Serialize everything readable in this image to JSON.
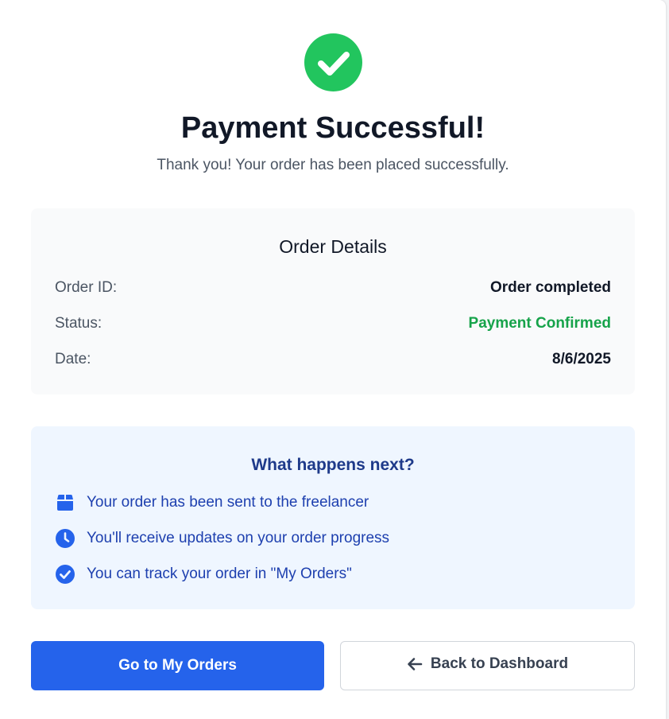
{
  "header": {
    "icon": "check-circle-icon",
    "title": "Payment Successful!",
    "subtitle": "Thank you! Your order has been placed successfully."
  },
  "order_details": {
    "heading": "Order Details",
    "rows": [
      {
        "label": "Order ID:",
        "value": "Order completed"
      },
      {
        "label": "Status:",
        "value": "Payment Confirmed"
      },
      {
        "label": "Date:",
        "value": "8/6/2025"
      }
    ]
  },
  "next_steps": {
    "heading": "What happens next?",
    "items": [
      {
        "icon": "box-icon",
        "text": "Your order has been sent to the freelancer"
      },
      {
        "icon": "clock-icon",
        "text": "You'll receive updates on your order progress"
      },
      {
        "icon": "check-circle-icon",
        "text": "You can track your order in \"My Orders\""
      }
    ]
  },
  "actions": {
    "primary_label": "Go to My Orders",
    "secondary_label": "Back to Dashboard",
    "secondary_icon": "arrow-left-icon"
  },
  "colors": {
    "success": "#22c55e",
    "status_green": "#16a34a",
    "primary": "#2563eb",
    "info_bg": "#eff6ff",
    "info_text": "#1e40af"
  }
}
